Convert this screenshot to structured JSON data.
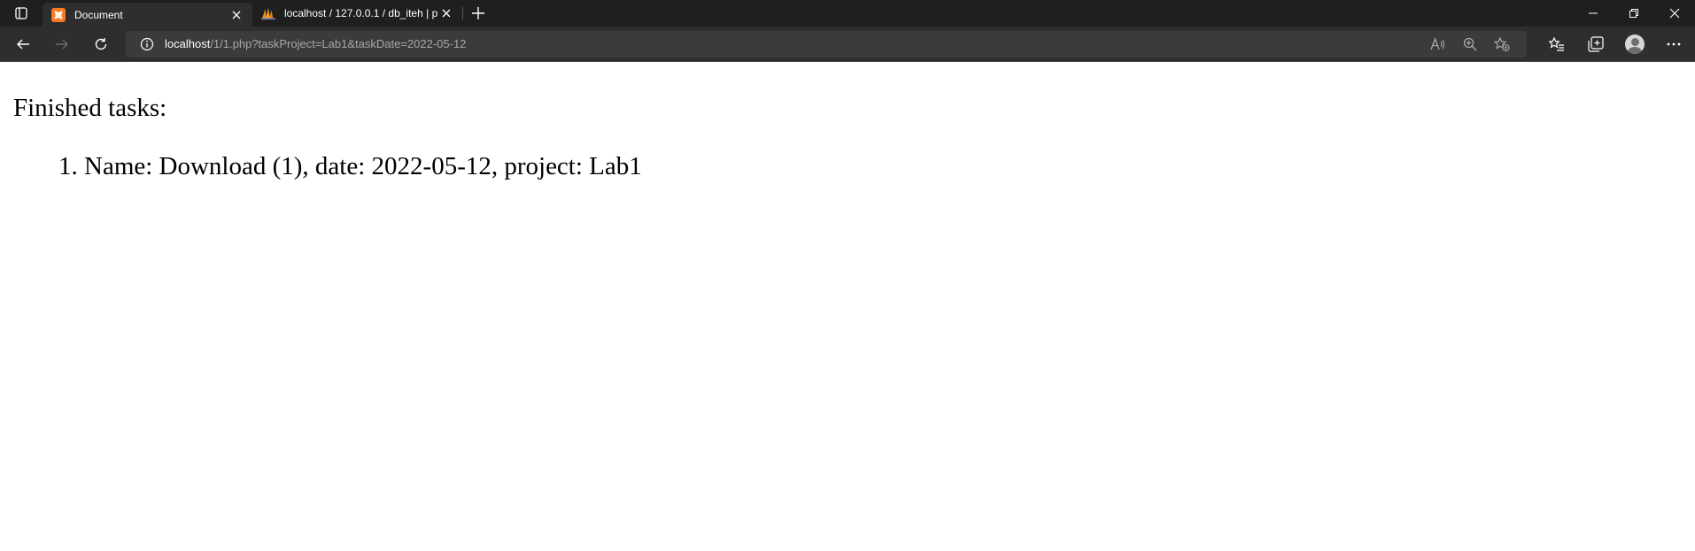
{
  "tabs": [
    {
      "title": "Document",
      "favicon": "xampp-icon",
      "active": true
    },
    {
      "title": "localhost / 127.0.0.1 / db_iteh | p",
      "favicon": "phpmyadmin-icon",
      "active": false
    }
  ],
  "address_bar": {
    "host": "localhost",
    "path": "/1/1.php?taskProject=Lab1&taskDate=2022-05-12"
  },
  "page": {
    "heading": "Finished tasks:",
    "tasks": [
      "Name: Download (1), date: 2022-05-12, project: Lab1"
    ]
  },
  "colors": {
    "tabstrip_bg": "#1f1f1f",
    "toolbar_bg": "#2e2e2e",
    "omnibox_bg": "#3b3b3b",
    "xampp_orange": "#fb7a24"
  }
}
